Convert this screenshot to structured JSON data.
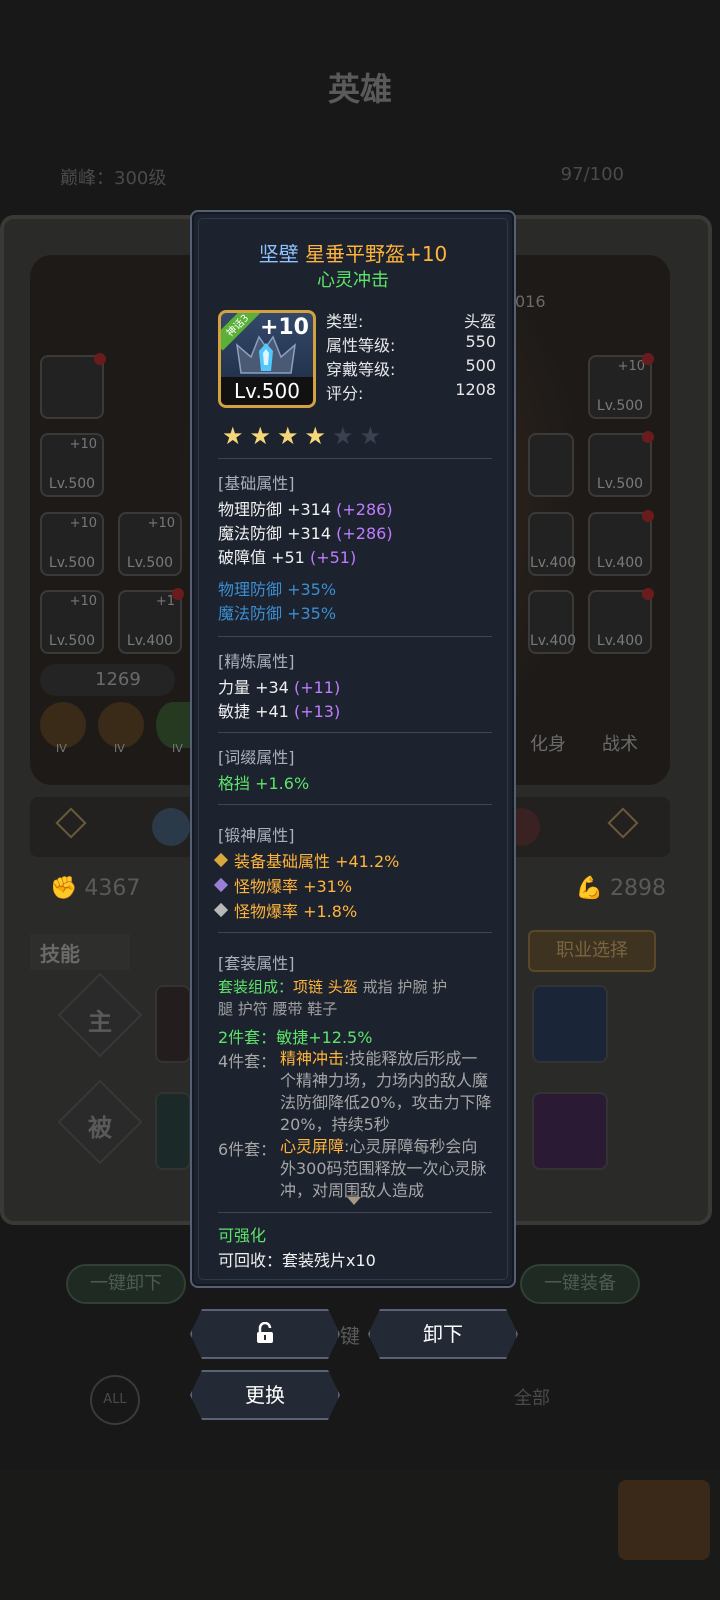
{
  "background": {
    "title": "英雄",
    "level_text": "巅峰：300级",
    "count_text": "97/100",
    "power_left": "4367",
    "power_right": "2898",
    "power_mid": "1269",
    "skills_tab": "技能",
    "job_button": "职业选择",
    "active_label": "主",
    "passive_label": "被",
    "unequip_all": "一键卸下",
    "equip_all": "一键装备",
    "transform_label": "化身",
    "tactics_label": "战术",
    "all_label": "全部",
    "partial_number": "016",
    "iv_label": "IV",
    "key_char": "键",
    "slot_levels": [
      "Lv.500",
      "Lv.500",
      "Lv.500",
      "Lv.500",
      "Lv.500",
      "Lv.400",
      "Lv.500",
      "Lv.400",
      "Lv.400",
      "Lv.400",
      "Lv.400",
      "Lv.400",
      "Lv.400"
    ]
  },
  "tooltip": {
    "title_prefix": "坚壁",
    "title_name": "星垂平野盔+10",
    "subtitle": "心灵冲击",
    "icon_plus": "+10",
    "icon_level": "Lv.500",
    "icon_tag": "神话3",
    "info": [
      {
        "k": "类型:",
        "v": "头盔"
      },
      {
        "k": "属性等级:",
        "v": "550"
      },
      {
        "k": "穿戴等级:",
        "v": "500"
      },
      {
        "k": "评分:",
        "v": "1208"
      }
    ],
    "stars_filled": 4,
    "stars_total": 6,
    "base_header": "[基础属性]",
    "base_lines": [
      {
        "text": "物理防御 +314",
        "extra": "(+286)"
      },
      {
        "text": "魔法防御 +314",
        "extra": "(+286)"
      },
      {
        "text": "破障值 +51",
        "extra": "(+51)"
      }
    ],
    "base_pct": [
      "物理防御 +35%",
      "魔法防御 +35%"
    ],
    "refine_header": "[精炼属性]",
    "refine_lines": [
      {
        "text": "力量 +34",
        "extra": "(+11)"
      },
      {
        "text": "敏捷 +41",
        "extra": "(+13)"
      }
    ],
    "affix_header": "[词缀属性]",
    "affix_line": "格挡 +1.6%",
    "forge_header": "[锻神属性]",
    "forge_lines": [
      {
        "text": "装备基础属性 +41.2%",
        "color": "#ffb43a",
        "diamond": "#d9a83a"
      },
      {
        "text": "怪物爆率 +31%",
        "color": "#ffb43a",
        "diamond": "#9a7fd6"
      },
      {
        "text": "怪物爆率 +1.8%",
        "color": "#ffb43a",
        "diamond": "#b8b8b8"
      }
    ],
    "set_header": "[套装属性]",
    "set_comp_label": "套装组成：",
    "set_comp_active": "项链 头盔",
    "set_comp_rest1": " 戒指 护腕 护",
    "set_comp_rest2": "腿 护符 腰带 鞋子",
    "set2_label": "2件套：",
    "set2_value": "敏捷+12.5%",
    "set4_label": "4件套：",
    "set4_name": "精神冲击",
    "set4_desc": ":技能释放后形成一个精神力场，力场内的敌人魔法防御降低20%，攻击力下降20%，持续5秒",
    "set6_label": "6件套：",
    "set6_name": "心灵屏障",
    "set6_desc": ":心灵屏障每秒会向外300码范围释放一次心灵脉冲，对周围敌人造成",
    "upgradable": "可强化",
    "recycle": "可回收：套装残片x10"
  },
  "actions": {
    "unequip": "卸下",
    "replace": "更换"
  },
  "colors": {
    "gold": "#ffb43a",
    "green": "#5ee36a",
    "purple": "#c07cff",
    "blue": "#3b8fd1",
    "panel": "#1c222e"
  }
}
